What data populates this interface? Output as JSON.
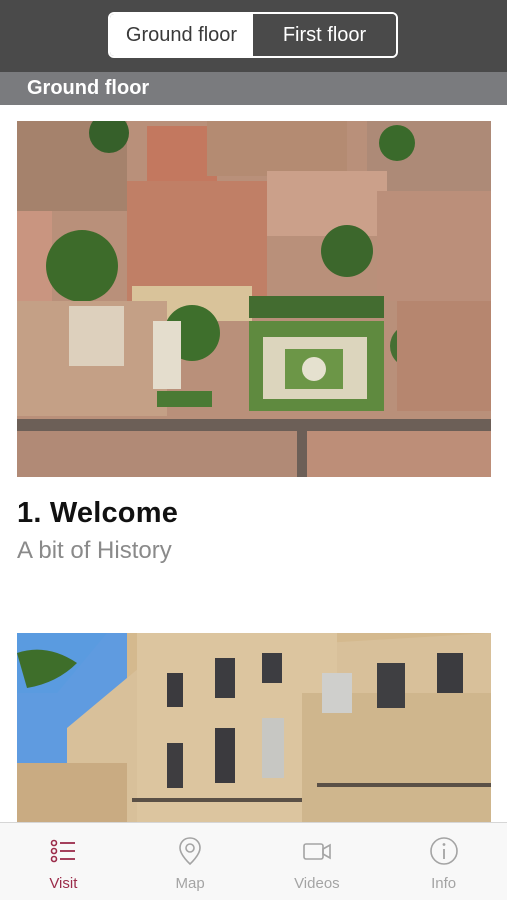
{
  "floor_switch": {
    "options": [
      "Ground floor",
      "First floor"
    ],
    "selected": "Ground floor"
  },
  "section": {
    "title": "Ground floor"
  },
  "items": [
    {
      "title": "1. Welcome",
      "subtitle": "A bit of History"
    }
  ],
  "tabs": [
    {
      "label": "Visit",
      "icon": "list-icon",
      "active": true
    },
    {
      "label": "Map",
      "icon": "map-pin-icon",
      "active": false
    },
    {
      "label": "Videos",
      "icon": "video-camera-icon",
      "active": false
    },
    {
      "label": "Info",
      "icon": "info-icon",
      "active": false
    }
  ],
  "colors": {
    "topbar": "#4a4a4a",
    "section_header": "#7a7b7e",
    "accent": "#9b2c4a",
    "inactive_tab": "#a4a4a4"
  }
}
